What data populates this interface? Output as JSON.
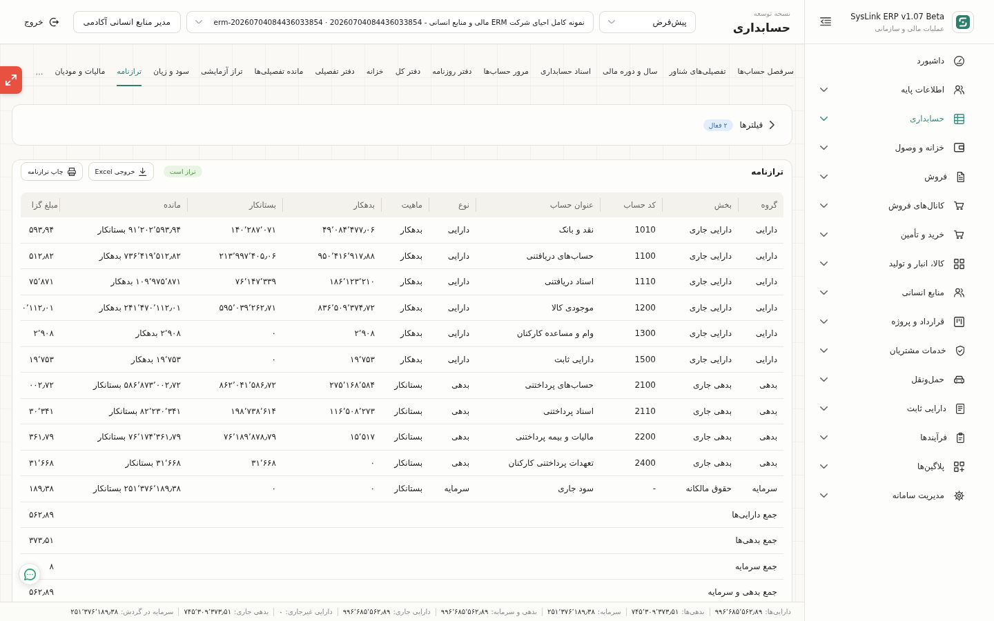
{
  "sidebar": {
    "brand": {
      "title": "SysLink ERP v1.07 Beta",
      "subtitle": "عملیات مالی و سازمانی"
    },
    "items": [
      {
        "label": "داشبورد",
        "expandable": false,
        "selected": false
      },
      {
        "label": "اطلاعات پایه",
        "expandable": true,
        "selected": false
      },
      {
        "label": "حسابداری",
        "expandable": true,
        "selected": true
      },
      {
        "label": "خزانه و وصول",
        "expandable": true,
        "selected": false
      },
      {
        "label": "فروش",
        "expandable": true,
        "selected": false
      },
      {
        "label": "کانال‌های فروش",
        "expandable": true,
        "selected": false
      },
      {
        "label": "خرید و تأمین",
        "expandable": true,
        "selected": false
      },
      {
        "label": "کالا، انبار و تولید",
        "expandable": true,
        "selected": false
      },
      {
        "label": "منابع انسانی",
        "expandable": true,
        "selected": false
      },
      {
        "label": "قرارداد و پروژه",
        "expandable": true,
        "selected": false
      },
      {
        "label": "خدمات مشتریان",
        "expandable": true,
        "selected": false
      },
      {
        "label": "حمل‌ونقل",
        "expandable": true,
        "selected": false
      },
      {
        "label": "دارایی ثابت",
        "expandable": true,
        "selected": false
      },
      {
        "label": "فرآیندها",
        "expandable": true,
        "selected": false
      },
      {
        "label": "پلاگین‌ها",
        "expandable": true,
        "selected": false
      },
      {
        "label": "مدیریت سامانه",
        "expandable": true,
        "selected": false
      }
    ]
  },
  "header": {
    "eyebrow": "نسخه توسعه",
    "title": "حسابداری",
    "selects": [
      {
        "value": "پیش‌فرض"
      },
      {
        "value": "نمونه کامل احیای شرکت ERM مالی و منابع انسانی - 20260704084436033854 · erm-20260704084436033854"
      }
    ],
    "role": "مدیر منابع انسانی آکادمی",
    "logout": "خروج"
  },
  "tabs": {
    "items": [
      {
        "label": "سرفصل حساب‌ها",
        "selected": false
      },
      {
        "label": "تفصیلی‌های شناور",
        "selected": false
      },
      {
        "label": "سال و دوره مالی",
        "selected": false
      },
      {
        "label": "اسناد حسابداری",
        "selected": false
      },
      {
        "label": "مرور حساب‌ها",
        "selected": false
      },
      {
        "label": "دفتر روزنامه",
        "selected": false
      },
      {
        "label": "دفتر کل",
        "selected": false
      },
      {
        "label": "خزانه",
        "selected": false
      },
      {
        "label": "دفتر تفصیلی",
        "selected": false
      },
      {
        "label": "مانده تفصیلی‌ها",
        "selected": false
      },
      {
        "label": "تراز آزمایشی",
        "selected": false
      },
      {
        "label": "سود و زیان",
        "selected": false
      },
      {
        "label": "ترازنامه",
        "selected": true
      },
      {
        "label": "مالیات و مودیان",
        "selected": false
      }
    ],
    "overflow": "…"
  },
  "filters": {
    "title": "فیلترها",
    "badge": "۲ فعال",
    "expanded": false
  },
  "balance_sheet": {
    "title": "ترازنامه",
    "status": "تراز است",
    "actions": [
      "خروجی Excel",
      "چاپ ترازنامه"
    ],
    "table": {
      "columns": [
        "گروه",
        "بخش",
        "کد حساب",
        "عنوان حساب",
        "نوع",
        "ماهیت",
        "بدهکار",
        "بستانکار",
        "مانده",
        "مبلغ گزا"
      ],
      "rows": [
        [
          "دارایی",
          "دارایی جاری",
          "1010",
          "نقد و بانک",
          "دارایی",
          "بدهکار",
          "۴۹٬۰۸۴٬۴۷۷٫۰۶",
          "۱۴۰٬۲۸۷٬۰۷۱",
          "۹۱٬۲۰۲٬۵۹۳٫۹۴ بستانکار",
          "۵۹۳٫۹۴"
        ],
        [
          "دارایی",
          "دارایی جاری",
          "1100",
          "حساب‌های دریافتنی",
          "دارایی",
          "بدهکار",
          "۹۵۰٬۴۱۶٬۹۱۷٫۸۸",
          "۲۱۳٬۹۹۷٬۴۰۵٫۰۶",
          "۷۳۶٬۴۱۹٬۵۱۲٫۸۲ بدهکار",
          "۵۱۲٫۸۲"
        ],
        [
          "دارایی",
          "دارایی جاری",
          "1110",
          "اسناد دریافتنی",
          "دارایی",
          "بدهکار",
          "۱۸۶٬۱۲۳٬۲۱۰",
          "۷۶٬۱۴۷٬۳۳۹",
          "۱۰۹٬۹۷۵٬۸۷۱ بدهکار",
          "۷۵٬۸۷۱"
        ],
        [
          "دارایی",
          "دارایی جاری",
          "1200",
          "موجودی کالا",
          "دارایی",
          "بدهکار",
          "۸۳۶٬۵۰۹٬۳۷۴٫۷۲",
          "۵۹۵٬۰۳۹٬۲۶۲٫۷۱",
          "۲۴۱٬۴۷۰٬۱۱۲٫۰۱ بدهکار",
          "۰٬۱۱۲٫۰۱"
        ],
        [
          "دارایی",
          "دارایی جاری",
          "1300",
          "وام و مساعده کارکنان",
          "دارایی",
          "بدهکار",
          "۲٬۹۰۸",
          "۰",
          "۲٬۹۰۸ بدهکار",
          "۲٬۹۰۸"
        ],
        [
          "دارایی",
          "دارایی جاری",
          "1500",
          "دارایی ثابت",
          "دارایی",
          "بدهکار",
          "۱۹٬۷۵۳",
          "۰",
          "۱۹٬۷۵۳ بدهکار",
          "۱۹٬۷۵۳"
        ],
        [
          "بدهی",
          "بدهی جاری",
          "2100",
          "حساب‌های پرداختنی",
          "بدهی",
          "بستانکار",
          "۲۷۵٬۱۶۸٬۵۸۴",
          "۸۶۲٬۰۴۱٬۵۸۶٫۷۲",
          "۵۸۶٬۸۷۳٬۰۰۲٫۷۲ بستانکار",
          "۰۰۲٫۷۲"
        ],
        [
          "بدهی",
          "بدهی جاری",
          "2110",
          "اسناد پرداختنی",
          "بدهی",
          "بستانکار",
          "۱۱۶٬۵۰۸٬۲۷۳",
          "۱۹۸٬۷۳۸٬۶۱۴",
          "۸۲٬۲۳۰٬۳۴۱ بستانکار",
          "۳۰٬۳۴۱"
        ],
        [
          "بدهی",
          "بدهی جاری",
          "2200",
          "مالیات و بیمه پرداختنی",
          "بدهی",
          "بستانکار",
          "۱۵٬۵۱۷",
          "۷۶٬۱۸۹٬۸۷۸٫۷۹",
          "۷۶٬۱۷۴٬۳۶۱٫۷۹ بستانکار",
          "۳۶۱٫۷۹"
        ],
        [
          "بدهی",
          "بدهی جاری",
          "2400",
          "تعهدات پرداختنی کارکنان",
          "بدهی",
          "بستانکار",
          "۰",
          "۳۱٬۶۶۸",
          "۳۱٬۶۶۸ بستانکار",
          "۳۱٬۶۶۸"
        ],
        [
          "سرمایه",
          "حقوق مالکانه",
          "-",
          "سود جاری",
          "سرمایه",
          "بستانکار",
          "۰",
          "۰",
          "۲۵۱٬۳۷۶٬۱۸۹٫۳۸ بستانکار",
          "۱۸۹٫۳۸"
        ]
      ],
      "totals": [
        {
          "label": "جمع دارایی‌ها",
          "value": "۵۶۲٫۸۹"
        },
        {
          "label": "جمع بدهی‌ها",
          "value": "۳۷۳٫۵۱"
        },
        {
          "label": "جمع سرمایه",
          "value": "۸"
        },
        {
          "label": "جمع بدهی و سرمایه",
          "value": "۵۶۲٫۸۹"
        }
      ]
    }
  },
  "status_bar": [
    {
      "label": "دارایی‌ها:",
      "value": "۹۹۶٬۶۸۵٬۵۶۲٫۸۹"
    },
    {
      "label": "بدهی‌ها:",
      "value": "۷۴۵٬۳۰۹٬۳۷۳٫۵۱"
    },
    {
      "label": "سرمایه:",
      "value": "۲۵۱٬۳۷۶٬۱۸۹٫۳۸"
    },
    {
      "label": "بدهی و سرمایه:",
      "value": "۹۹۶٬۶۸۵٬۵۶۲٫۸۹"
    },
    {
      "label": "دارایی جاری:",
      "value": "۹۹۶٬۶۸۵٬۵۶۲٫۸۹"
    },
    {
      "label": "دارایی غیرجاری:",
      "value": "۰"
    },
    {
      "label": "بدهی جاری:",
      "value": "۷۴۵٬۳۰۹٬۳۷۳٫۵۱"
    },
    {
      "label": "سرمایه در گردش:",
      "value": "۲۵۱٬۳۷۶٬۱۸۹٫۳۸"
    }
  ]
}
